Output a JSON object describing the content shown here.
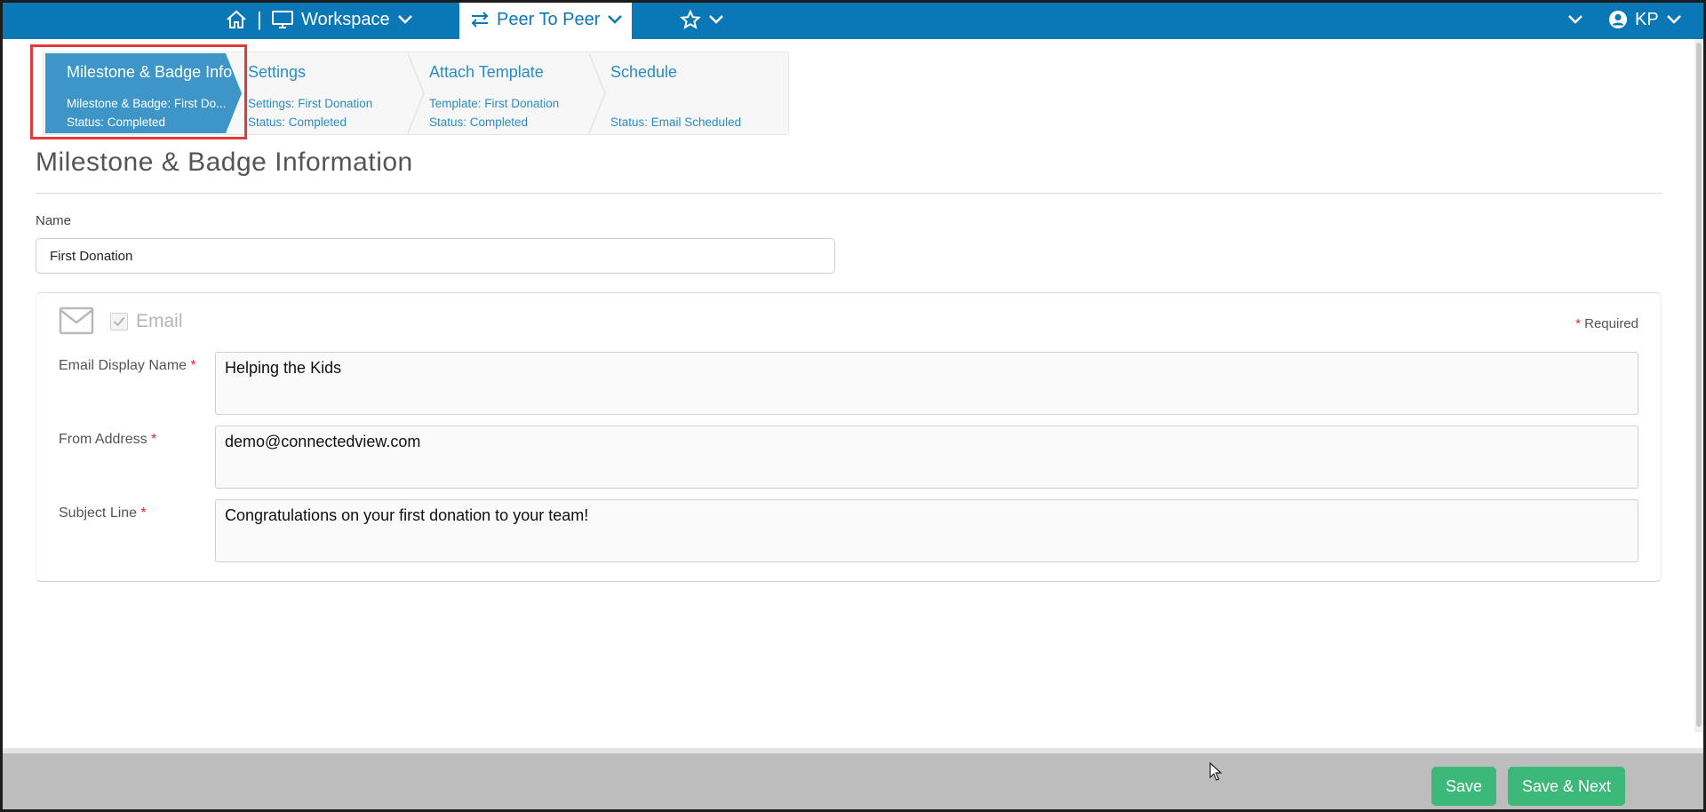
{
  "topnav": {
    "workspace_label": "Workspace",
    "peer_label": "Peer To Peer",
    "separator": "|",
    "user_initials": "KP",
    "colors": {
      "nav_bg": "#0a78b7",
      "active_bg": "#ffffff"
    }
  },
  "wizard": {
    "steps": [
      {
        "title": "Milestone & Badge Info",
        "line1": "Milestone & Badge: First Do...",
        "line2": "Status: Completed",
        "state": "active"
      },
      {
        "title": "Settings",
        "line1": "Settings: First Donation",
        "line2": "Status: Completed",
        "state": "done"
      },
      {
        "title": "Attach Template",
        "line1": "Template: First Donation",
        "line2": "Status: Completed",
        "state": "done"
      },
      {
        "title": "Schedule",
        "line1": "",
        "line2": "Status: Email Scheduled",
        "state": "done"
      }
    ],
    "active_color": "#3d96c7"
  },
  "page": {
    "title": "Milestone & Badge Information",
    "name_label": "Name",
    "name_value": "First Donation"
  },
  "email": {
    "label": "Email",
    "checked": true,
    "required_note": "Required",
    "required_marker": "*",
    "fields": [
      {
        "label": "Email Display Name",
        "value": "Helping the Kids"
      },
      {
        "label": "From Address",
        "value": "demo@connectedview.com"
      },
      {
        "label": "Subject Line",
        "value": "Congratulations on your first donation to your team!"
      }
    ]
  },
  "footer": {
    "save_label": "Save",
    "save_next_label": "Save & Next",
    "button_color": "#3cb878"
  },
  "icons": [
    "home-icon",
    "monitor-icon",
    "chevron-down-icon",
    "transfer-arrows-icon",
    "star-icon",
    "user-circle-icon",
    "envelope-icon",
    "check-icon",
    "mouse-cursor-icon"
  ]
}
